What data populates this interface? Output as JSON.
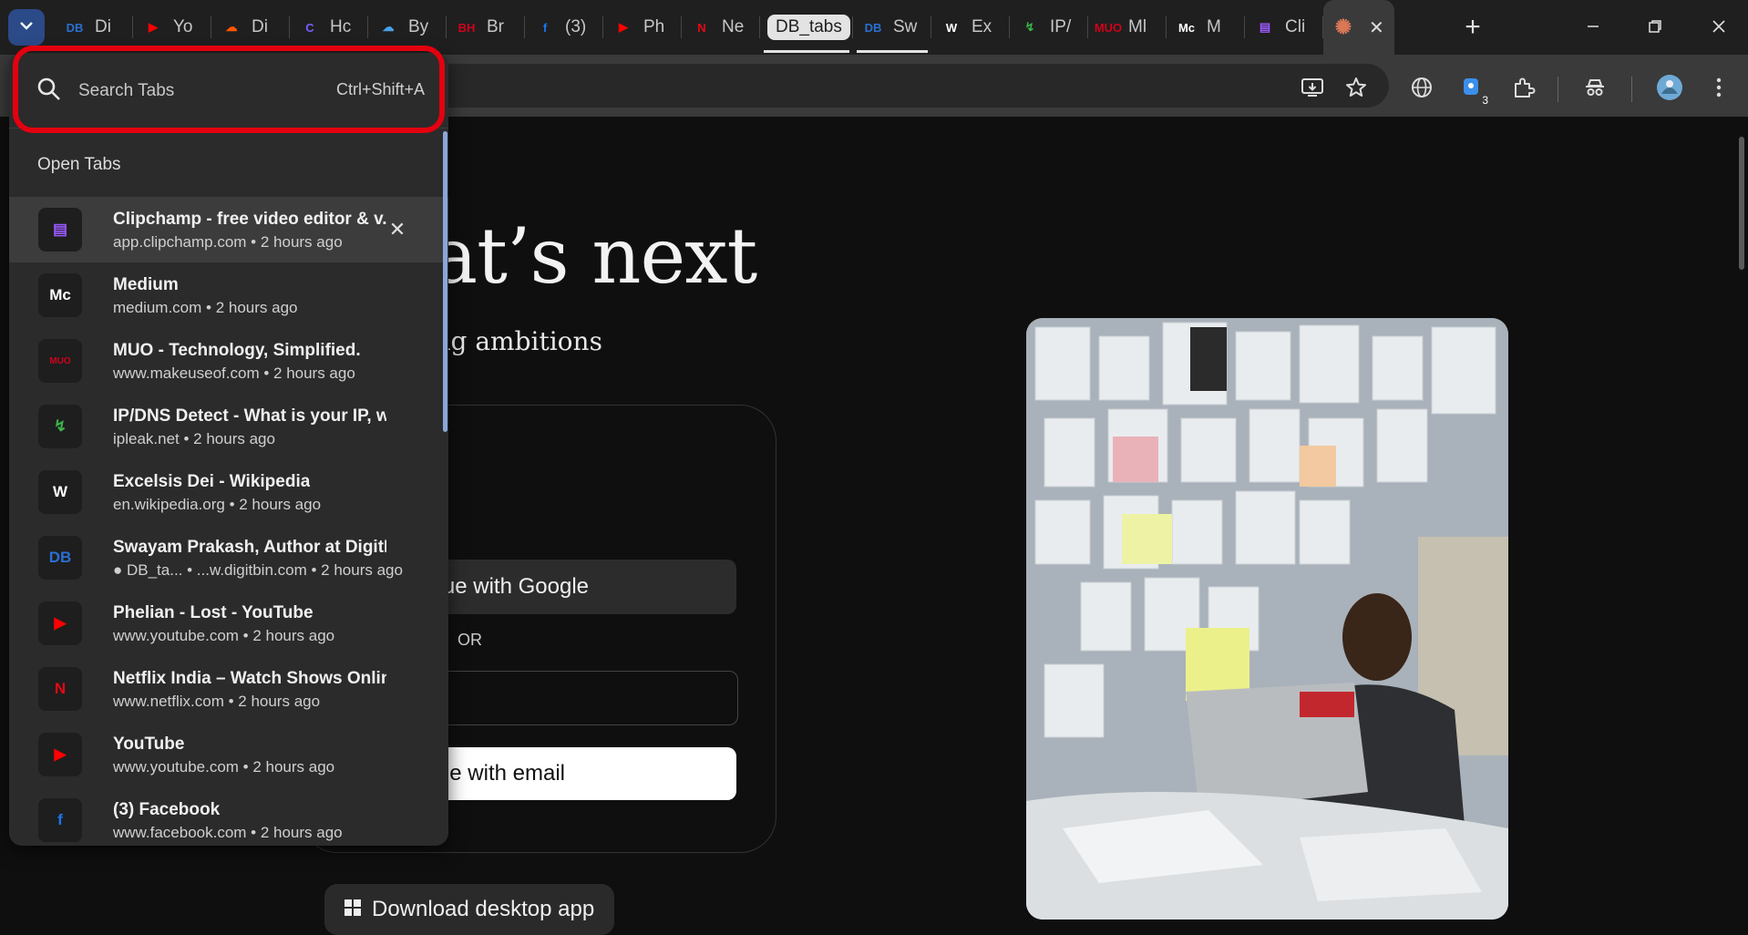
{
  "tabstrip": {
    "tabs": [
      {
        "id": "digitbin1",
        "label": "Di",
        "icon": "digitbin-icon",
        "icon_text": "DB",
        "icon_color": "#2a6fd1"
      },
      {
        "id": "youtube1",
        "label": "Yo",
        "icon": "youtube-icon",
        "icon_text": "▶",
        "icon_color": "#ff0000"
      },
      {
        "id": "soundcloud",
        "label": "Di",
        "icon": "soundcloud-icon",
        "icon_text": "☁",
        "icon_color": "#ff5500"
      },
      {
        "id": "hc",
        "label": "Hc",
        "icon": "c-circle-icon",
        "icon_text": "C",
        "icon_color": "#7b5cff"
      },
      {
        "id": "onedrive",
        "label": "By",
        "icon": "cloud-icon",
        "icon_text": "☁",
        "icon_color": "#4aa0e6"
      },
      {
        "id": "bh",
        "label": "Br",
        "icon": "bh-icon",
        "icon_text": "BH",
        "icon_color": "#d0021b"
      },
      {
        "id": "facebook",
        "label": "(3)",
        "icon": "facebook-icon",
        "icon_text": "f",
        "icon_color": "#1877f2"
      },
      {
        "id": "youtube2",
        "label": "Ph",
        "icon": "youtube-icon",
        "icon_text": "▶",
        "icon_color": "#ff0000"
      },
      {
        "id": "netflix",
        "label": "Ne",
        "icon": "netflix-icon",
        "icon_text": "N",
        "icon_color": "#e50914"
      }
    ],
    "group_label": "DB_tabs",
    "grouped_tabs": [
      {
        "id": "swayam",
        "label": "Sw",
        "icon": "digitbin-icon",
        "icon_text": "DB",
        "icon_color": "#2a6fd1"
      }
    ],
    "tabs_after": [
      {
        "id": "wiki",
        "label": "Ex",
        "icon": "wikipedia-icon",
        "icon_text": "W",
        "icon_color": "#ffffff"
      },
      {
        "id": "ipleak",
        "label": "IP/",
        "icon": "ipleak-icon",
        "icon_text": "↯",
        "icon_color": "#3bb34a"
      },
      {
        "id": "muo",
        "label": "Ml",
        "icon": "muo-icon",
        "icon_text": "MUO",
        "icon_color": "#d0021b"
      },
      {
        "id": "medium",
        "label": "M",
        "icon": "medium-icon",
        "icon_text": "Mc",
        "icon_color": "#ffffff"
      },
      {
        "id": "clipchamp",
        "label": "Cli",
        "icon": "clipchamp-icon",
        "icon_text": "▤",
        "icon_color": "#9b59ff"
      }
    ],
    "active_tab": {
      "icon": "claude-icon",
      "icon_text": "✺",
      "icon_color": "#d97757"
    }
  },
  "dropdown": {
    "search_placeholder": "Search Tabs",
    "shortcut": "Ctrl+Shift+A",
    "section_title": "Open Tabs",
    "items": [
      {
        "title": "Clipchamp - free video editor & v...",
        "sub": "app.clipchamp.com • 2 hours ago",
        "icon": "clipchamp-icon",
        "icon_text": "▤",
        "icon_color": "#9b59ff"
      },
      {
        "title": "Medium",
        "sub": "medium.com • 2 hours ago",
        "icon": "medium-icon",
        "icon_text": "Mc",
        "icon_color": "#ffffff"
      },
      {
        "title": "MUO - Technology, Simplified.",
        "sub": "www.makeuseof.com • 2 hours ago",
        "icon": "muo-icon",
        "icon_text": "MUO",
        "icon_color": "#d0021b"
      },
      {
        "title": "IP/DNS Detect - What is your IP, what...",
        "sub": "ipleak.net • 2 hours ago",
        "icon": "ipleak-icon",
        "icon_text": "↯",
        "icon_color": "#3bb34a"
      },
      {
        "title": "Excelsis Dei - Wikipedia",
        "sub": "en.wikipedia.org • 2 hours ago",
        "icon": "wikipedia-icon",
        "icon_text": "W",
        "icon_color": "#ffffff"
      },
      {
        "title": "Swayam Prakash, Author at DigitBin",
        "sub": "● DB_ta... • ...w.digitbin.com • 2 hours ago",
        "icon": "digitbin-icon",
        "icon_text": "DB",
        "icon_color": "#2a6fd1"
      },
      {
        "title": "Phelian - Lost - YouTube",
        "sub": "www.youtube.com • 2 hours ago",
        "icon": "youtube-icon",
        "icon_text": "▶",
        "icon_color": "#ff0000"
      },
      {
        "title": "Netflix India – Watch Shows Online, ...",
        "sub": "www.netflix.com • 2 hours ago",
        "icon": "netflix-icon",
        "icon_text": "N",
        "icon_color": "#e50914"
      },
      {
        "title": "YouTube",
        "sub": "www.youtube.com • 2 hours ago",
        "icon": "youtube-icon",
        "icon_text": "▶",
        "icon_color": "#ff0000"
      },
      {
        "title": "(3) Facebook",
        "sub": "www.facebook.com • 2 hours ago",
        "icon": "facebook-icon",
        "icon_text": "f",
        "icon_color": "#1877f2"
      }
    ]
  },
  "toolbar": {
    "extension_badge": "3"
  },
  "page": {
    "hero_title": "what’s next",
    "hero_subtitle": "tner for big ambitions",
    "google_button": "ue with Google",
    "or_label": "OR",
    "email_button": "e with email",
    "download_button": "Download desktop app"
  },
  "colors": {
    "highlight": "#e3000f",
    "tabsearch_button": "#2b4a88"
  }
}
